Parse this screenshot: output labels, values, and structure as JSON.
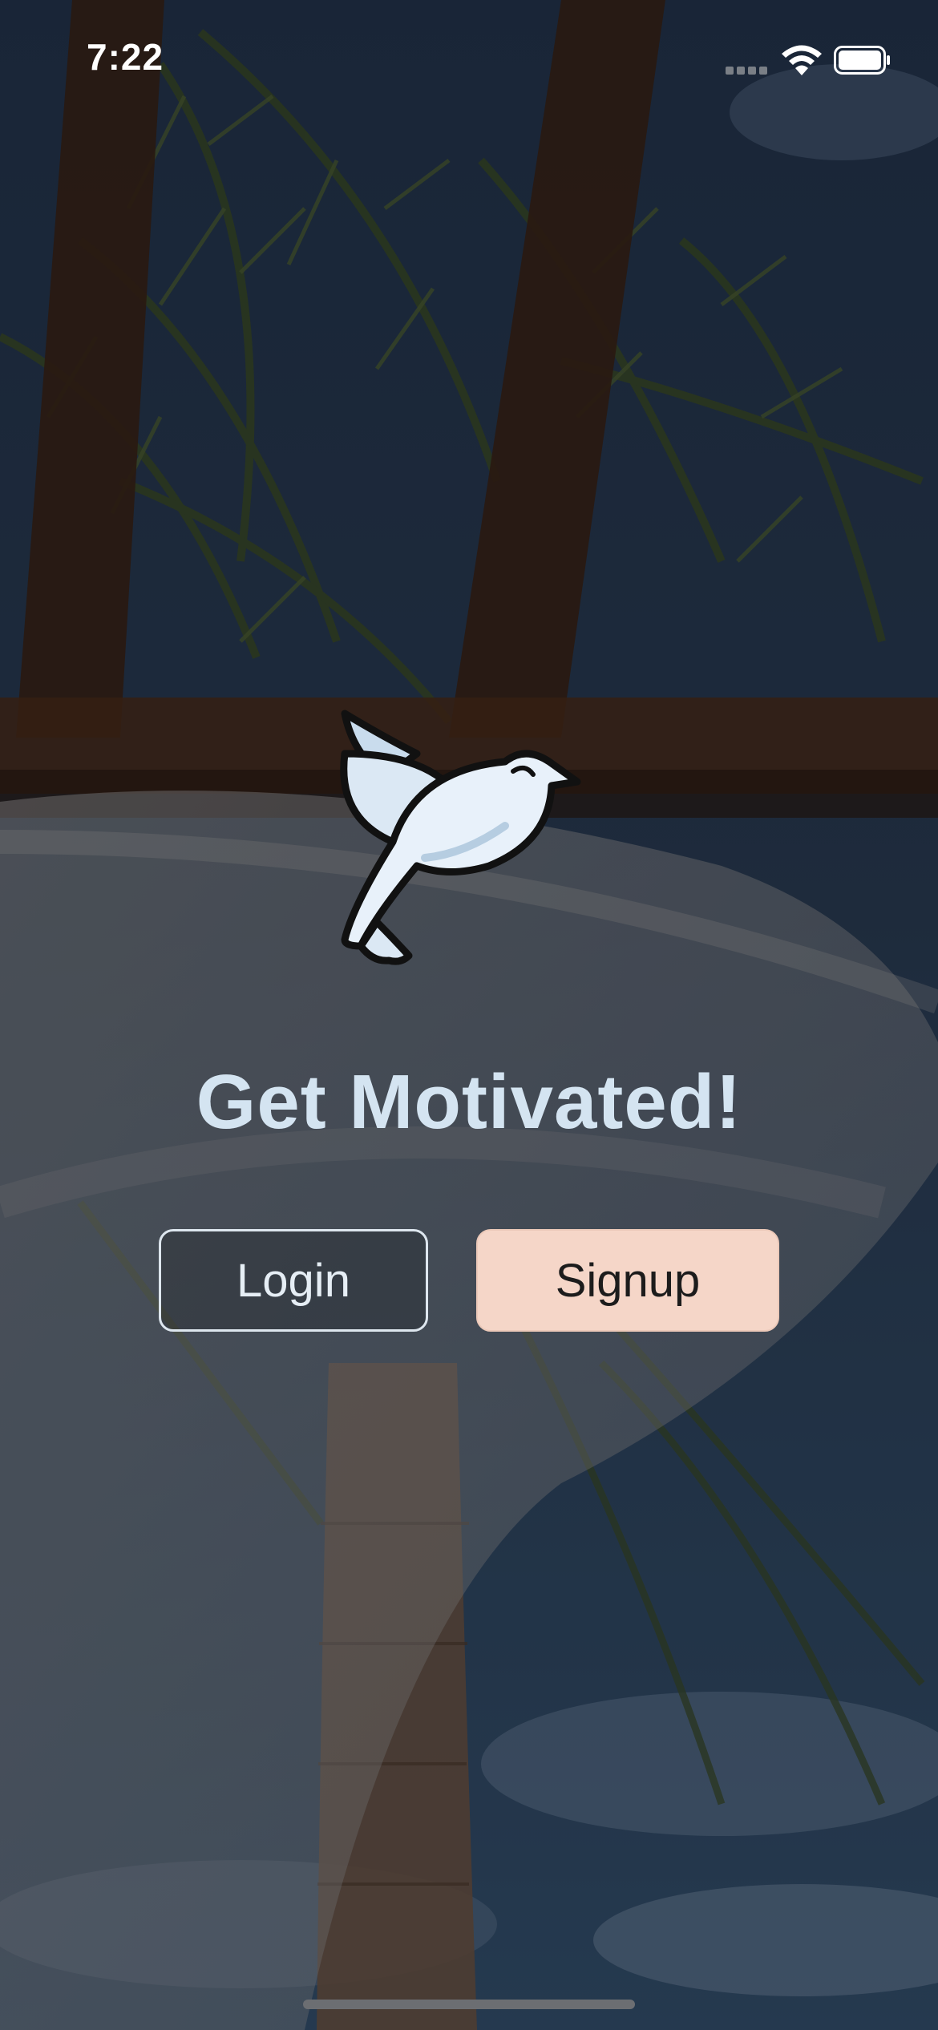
{
  "status_bar": {
    "time": "7:22"
  },
  "hero": {
    "title": "Get Motivated!",
    "logo_icon": "dove-icon"
  },
  "actions": {
    "login_label": "Login",
    "signup_label": "Signup"
  },
  "colors": {
    "title": "#d4e4f1",
    "signup_bg": "#f5d6c8",
    "login_border": "#dde6ee"
  }
}
